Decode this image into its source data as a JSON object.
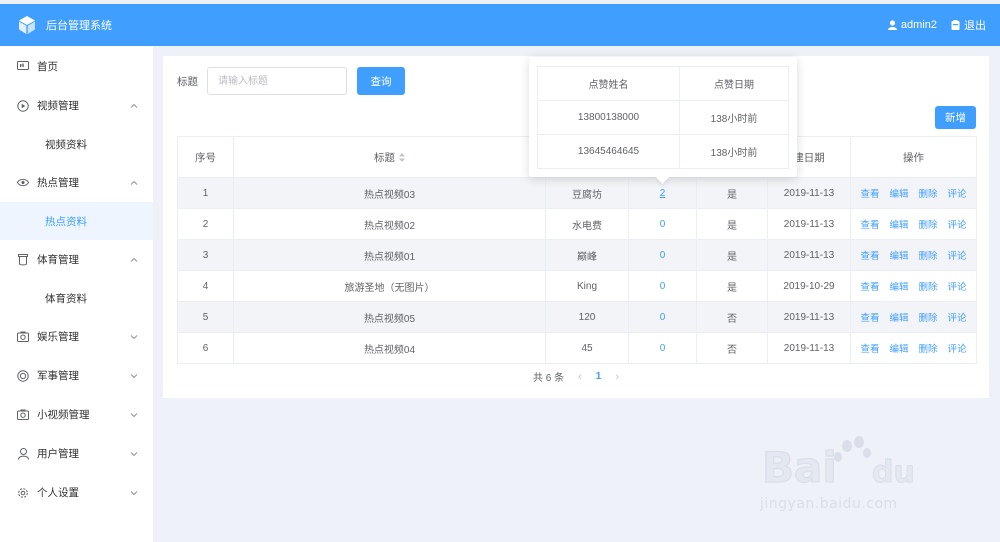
{
  "header": {
    "app_title": "后台管理系统",
    "username": "admin2",
    "logout": "退出"
  },
  "sidebar": {
    "items": [
      {
        "label": "首页"
      },
      {
        "label": "视频管理",
        "sub": "视频资料"
      },
      {
        "label": "热点管理",
        "sub": "热点资料"
      },
      {
        "label": "体育管理",
        "sub": "体育资料"
      },
      {
        "label": "娱乐管理"
      },
      {
        "label": "军事管理"
      },
      {
        "label": "小视频管理"
      },
      {
        "label": "用户管理"
      },
      {
        "label": "个人设置"
      }
    ]
  },
  "search": {
    "label": "标题",
    "placeholder": "请输入标题",
    "button": "查询",
    "add_button": "新增"
  },
  "table": {
    "headers": [
      "序号",
      "标题",
      "",
      "",
      "",
      "建日期",
      "操作"
    ],
    "rows": [
      {
        "idx": "1",
        "title": "热点视频03",
        "author": "豆腐坊",
        "likes": "2",
        "flag": "是",
        "date": "2019-11-13"
      },
      {
        "idx": "2",
        "title": "热点视频02",
        "author": "水电费",
        "likes": "0",
        "flag": "是",
        "date": "2019-11-13"
      },
      {
        "idx": "3",
        "title": "热点视频01",
        "author": "巅峰",
        "likes": "0",
        "flag": "是",
        "date": "2019-11-13"
      },
      {
        "idx": "4",
        "title": "旅游圣地（无图片）",
        "author": "King",
        "likes": "0",
        "flag": "是",
        "date": "2019-10-29"
      },
      {
        "idx": "5",
        "title": "热点视频05",
        "author": "120",
        "likes": "0",
        "flag": "否",
        "date": "2019-11-13"
      },
      {
        "idx": "6",
        "title": "热点视频04",
        "author": "45",
        "likes": "0",
        "flag": "否",
        "date": "2019-11-13"
      }
    ],
    "ops": [
      "查看",
      "编辑",
      "删除",
      "评论"
    ]
  },
  "pagination": {
    "total": "共 6 条",
    "prev": "‹",
    "current": "1",
    "next": "›"
  },
  "popover": {
    "headers": [
      "点赞姓名",
      "点赞日期"
    ],
    "rows": [
      {
        "name": "13800138000",
        "date": "138小时前"
      },
      {
        "name": "13645464645",
        "date": "138小时前"
      }
    ]
  },
  "watermark": {
    "url": "jingyan.baidu.com"
  },
  "colors": {
    "primary": "#409eff",
    "bg": "#eef1f8",
    "active_bg": "#eef5fe"
  }
}
